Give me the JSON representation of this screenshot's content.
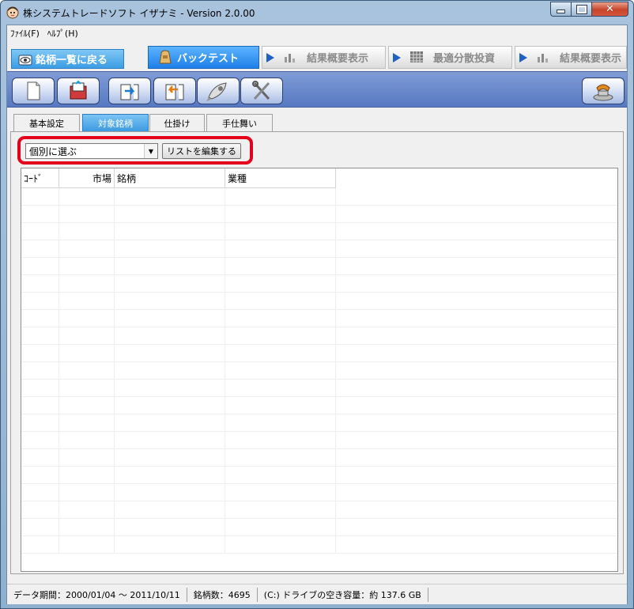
{
  "window": {
    "title": "株システムトレードソフト イザナミ - Version 2.0.00"
  },
  "menu": [
    {
      "label": "ﾌｧｲﾙ(F)"
    },
    {
      "label": "ﾍﾙﾌﾟ(H)"
    }
  ],
  "tabs": [
    {
      "label": "銘柄一覧に戻る",
      "icon": "eye-icon"
    },
    {
      "label": "バックテスト",
      "icon": "bag-icon"
    },
    {
      "label": "結果概要表示",
      "icon": "chart-icon"
    },
    {
      "label": "最適分散投資",
      "icon": "grid-icon"
    },
    {
      "label": "結果概要表示",
      "icon": "chart-icon"
    }
  ],
  "toolbar": {
    "icons": [
      "new-document-icon",
      "open-icon",
      "export-icon",
      "import-icon",
      "rocket-icon",
      "tools-icon",
      "phone-icon"
    ]
  },
  "subtabs": [
    {
      "label": "基本設定"
    },
    {
      "label": "対象銘柄"
    },
    {
      "label": "仕掛け"
    },
    {
      "label": "手仕舞い"
    }
  ],
  "filter": {
    "selected": "個別に選ぶ",
    "edit_button": "リストを編集する"
  },
  "grid": {
    "columns": [
      {
        "label": "ｺｰﾄﾞ"
      },
      {
        "label": "市場"
      },
      {
        "label": "銘柄"
      },
      {
        "label": "業種"
      }
    ]
  },
  "status": {
    "period": "データ期間：2000/01/04 〜 2011/10/11",
    "count": "銘柄数：4695",
    "disk": "(C:) ドライブの空き容量：約 137.6 GB"
  },
  "colors": {
    "highlight": "#e4001b",
    "active_tab": "#1e7fe8",
    "toolbar": "#5778c2"
  }
}
